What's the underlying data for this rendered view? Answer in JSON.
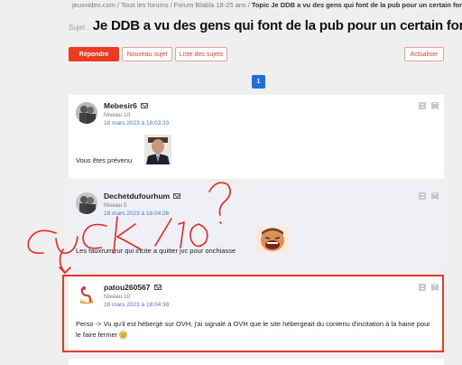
{
  "breadcrumb": {
    "items": [
      "jeuxvideo.com",
      "Tous les forums",
      "Forum Blabla 18-25 ans"
    ],
    "separator": "/",
    "current": "Topic Je DDB a vu des gens qui font de la pub pour un certain forum"
  },
  "topic": {
    "label": "Sujet :",
    "title": "Je DDB a vu des gens qui font de la pub pour un certain forum"
  },
  "toolbar": {
    "reply": "Répondre",
    "new_topic": "Nouveau sujet",
    "topic_list": "Liste des sujets",
    "refresh": "Actualiser"
  },
  "pagination": {
    "current": "1"
  },
  "posts": [
    {
      "author": "Mebesir6",
      "level": "Niveau 10",
      "date": "18 mars 2023 à 18:03:33",
      "text": "Vous êtes prévenu",
      "image": "man-in-suit-image"
    },
    {
      "author": "Dechetdufourhum",
      "level": "Niveau 5",
      "date": "18 mars 2023 à 18:04:26",
      "text": "Les fauxrumeur qui incite a quitter jvc pour onchiasse",
      "image": "laughing-man-sticker"
    },
    {
      "author": "patou260567",
      "level": "Niveau 10",
      "date": "18 mars 2023 à 18:04:38",
      "text": "Perso -> Vu qu'il est hébergé sur OVH, j'ai signalé à OVH que le site hébergeait du contenu d'incitation à la haine pour le faire fermer",
      "emoji": "smiley-icon"
    }
  ],
  "annotation": {
    "text": "CUCK / 10 ?",
    "color": "#e8271d"
  },
  "colors": {
    "accent": "#ee3a1f",
    "link": "#4a77d4",
    "page_active": "#1f6fdc",
    "highlight": "#e23b2b"
  }
}
